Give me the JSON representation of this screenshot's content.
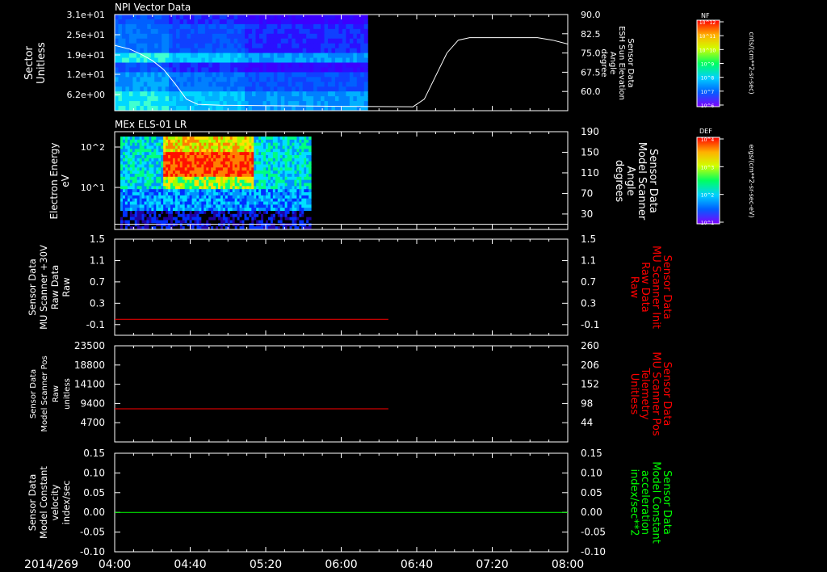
{
  "colors": {
    "background": "#000000",
    "axes": "#ffffff",
    "trace_white": "#ffffff",
    "trace_red": "#ff0000",
    "trace_green": "#00ff00",
    "label_red": "#ff0000",
    "label_green": "#00ff00"
  },
  "time_axis": {
    "date_label": "2014/269",
    "ticks": [
      "04:00",
      "04:40",
      "05:20",
      "06:00",
      "06:40",
      "07:20",
      "08:00"
    ],
    "range": [
      "04:00",
      "08:00"
    ]
  },
  "colorbars": [
    {
      "title": "NF",
      "units": "cnts/(cm**2-sr-sec)",
      "tick_labels": [
        "10^12",
        "10^11",
        "10^10",
        "10^9",
        "10^8",
        "10^7",
        "10^6"
      ]
    },
    {
      "title": "DEF",
      "units": "ergs/(cm**2-sr-sec-eV)",
      "tick_labels": [
        "10^4",
        "10^3",
        "10^2",
        "10^1"
      ]
    }
  ],
  "chart_data": [
    {
      "type": "heatmap",
      "title": "NPI Vector Data",
      "ylabel": [
        "Sector",
        "Unitless"
      ],
      "y_tick_labels": [
        "3.1e+01",
        "2.5e+01",
        "1.9e+01",
        "1.2e+01",
        "6.2e+00"
      ],
      "data_time_range": [
        "04:00",
        "06:14"
      ],
      "overlay": {
        "type": "line",
        "ylabel": [
          "Sensor Data",
          "ESH Sun Elevation",
          "Angle",
          "degree"
        ],
        "y_tick_labels": [
          "90.0",
          "82.5",
          "75.0",
          "67.5",
          "60.0"
        ],
        "ylim": [
          52.5,
          90.0
        ],
        "points": [
          [
            "04:00",
            78.0
          ],
          [
            "04:08",
            76.5
          ],
          [
            "04:14",
            74.5
          ],
          [
            "04:20",
            72.0
          ],
          [
            "04:26",
            68.5
          ],
          [
            "04:32",
            63.0
          ],
          [
            "04:38",
            57.0
          ],
          [
            "04:44",
            55.0
          ],
          [
            "04:56",
            54.6
          ],
          [
            "05:30",
            54.4
          ],
          [
            "06:00",
            54.2
          ],
          [
            "06:38",
            54.0
          ],
          [
            "06:44",
            57.0
          ],
          [
            "06:50",
            66.0
          ],
          [
            "06:56",
            75.0
          ],
          [
            "07:02",
            80.0
          ],
          [
            "07:08",
            81.0
          ],
          [
            "07:44",
            81.0
          ],
          [
            "07:52",
            80.0
          ],
          [
            "08:00",
            78.5
          ]
        ]
      }
    },
    {
      "type": "heatmap",
      "title": "MEx ELS-01 LR",
      "ylabel": [
        "Electron Energy",
        "eV"
      ],
      "y_tick_labels": [
        "10^2",
        "10^1"
      ],
      "data_time_range": [
        "04:00",
        "05:44"
      ],
      "overlay": {
        "type": "line",
        "ylabel": [
          "Sensor Data",
          "Model Scanner",
          "Angle",
          "degrees"
        ],
        "y_tick_labels": [
          "190",
          "150",
          "110",
          "70",
          "30"
        ],
        "ylim": [
          0,
          190
        ],
        "points": [
          [
            "04:00",
            10
          ],
          [
            "08:00",
            10
          ]
        ]
      }
    },
    {
      "type": "line",
      "ylabel": [
        "Sensor Data",
        "MU Scanner +30V",
        "Raw Data",
        "Raw"
      ],
      "y_tick_labels": [
        "1.5",
        "1.1",
        "0.7",
        "0.3",
        "-0.1"
      ],
      "ylim": [
        -0.3,
        1.5
      ],
      "right_ylabel": [
        "Sensor Data",
        "MU Scanner Init",
        "Raw Data",
        "Raw"
      ],
      "right_y_tick_labels": [
        "1.5",
        "1.1",
        "0.7",
        "0.3",
        "-0.1"
      ],
      "series": [
        {
          "color": "#ff0000",
          "points": [
            [
              "04:00",
              0.0
            ],
            [
              "06:25",
              0.0
            ]
          ]
        }
      ]
    },
    {
      "type": "line",
      "ylabel": [
        "Sensor Data",
        "Model Scanner Pos",
        "Raw",
        "unitless"
      ],
      "y_tick_labels": [
        "23500",
        "18800",
        "14100",
        "9400",
        "4700"
      ],
      "ylim": [
        0,
        23500
      ],
      "right_ylabel": [
        "Sensor Data",
        "MU Scanner Pos",
        "Telemetry",
        "Unitless"
      ],
      "right_y_tick_labels": [
        "260",
        "206",
        "152",
        "98",
        "44"
      ],
      "series": [
        {
          "color": "#ff0000",
          "points": [
            [
              "04:00",
              8100
            ],
            [
              "06:25",
              8100
            ]
          ]
        }
      ]
    },
    {
      "type": "line",
      "ylabel": [
        "Sensor Data",
        "Model Constant",
        "velocity",
        "index/sec"
      ],
      "y_tick_labels": [
        "0.15",
        "0.10",
        "0.05",
        "0.00",
        "-0.05",
        "-0.10"
      ],
      "ylim": [
        -0.1,
        0.15
      ],
      "right_ylabel": [
        "Sensor Data",
        "Model Constant",
        "acceleration",
        "index/sec**2"
      ],
      "right_y_tick_labels": [
        "0.15",
        "0.10",
        "0.05",
        "0.00",
        "-0.05",
        "-0.10"
      ],
      "series": [
        {
          "color": "#00ff00",
          "points": [
            [
              "04:00",
              0.0
            ],
            [
              "08:00",
              0.0
            ]
          ]
        }
      ]
    }
  ]
}
